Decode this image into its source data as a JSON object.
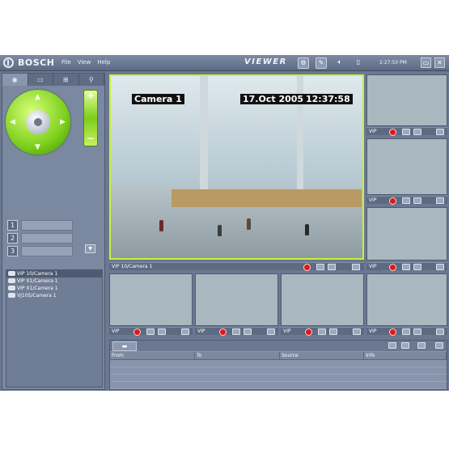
{
  "window": {
    "brand": "BOSCH",
    "app_name": "VIEWER",
    "menu": [
      "File",
      "View",
      "Help"
    ],
    "clock": "2:27:50 PM"
  },
  "left_panel": {
    "presets": [
      "1",
      "2",
      "3"
    ],
    "camera_tree": [
      {
        "label": "VIP 10/Camera 1",
        "selected": true
      },
      {
        "label": "VIP X1/Camera 1",
        "selected": false
      },
      {
        "label": "VIP X1/Camera 1",
        "selected": false
      },
      {
        "label": "VJ10S/Camera 1",
        "selected": false
      }
    ]
  },
  "main_video": {
    "camera_name": "Camera 1",
    "date": "17.Oct 2005",
    "time": "12:37:58",
    "bar_label": "VIP 10/Camera 1",
    "highlight_color": "#c6f23a"
  },
  "thumbnails": {
    "side_labels": [
      "VIP",
      "VIP",
      "VIP"
    ],
    "bottom_labels": [
      "VIP",
      "VIP",
      "VIP",
      "VIP"
    ]
  },
  "log_table": {
    "columns": [
      "From",
      "To",
      "Source",
      "Info"
    ]
  }
}
